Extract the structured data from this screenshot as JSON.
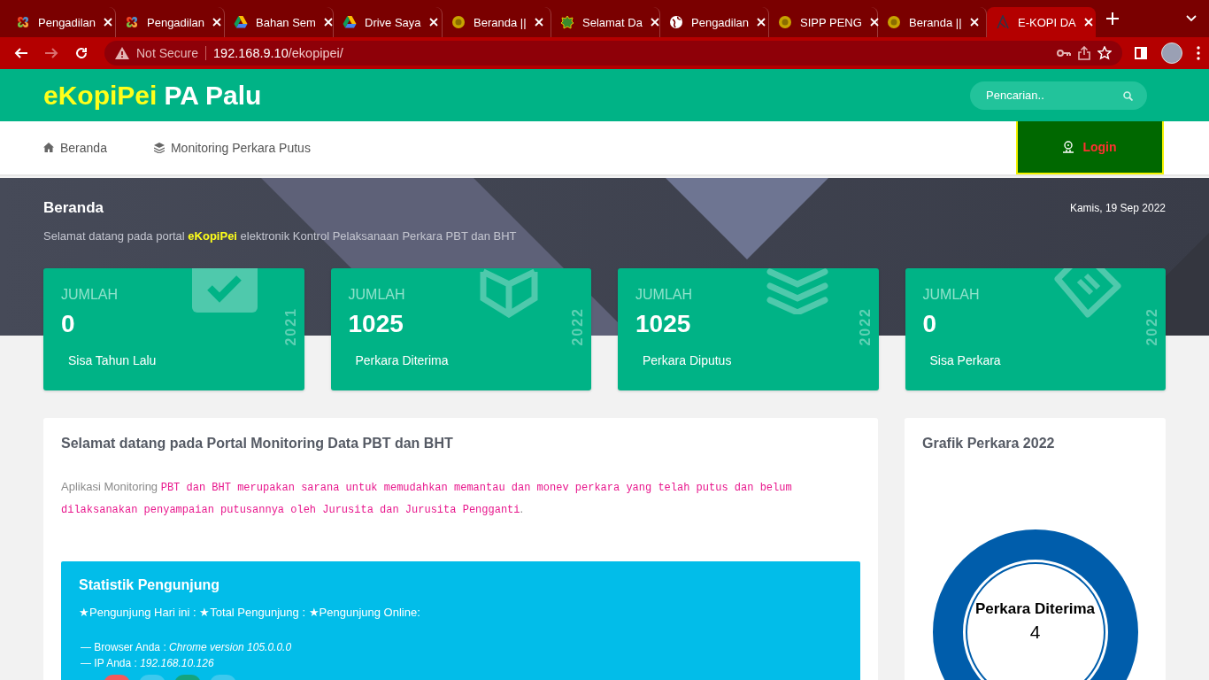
{
  "browser": {
    "tabs": [
      {
        "title": "Pengadilan",
        "kind": "joomla",
        "selected": false
      },
      {
        "title": "Pengadilan",
        "kind": "joomla",
        "selected": false
      },
      {
        "title": "Bahan Sem",
        "kind": "drive",
        "selected": false
      },
      {
        "title": "Drive Saya",
        "kind": "drive",
        "selected": false
      },
      {
        "title": "Beranda ||",
        "kind": "seal",
        "selected": false
      },
      {
        "title": "Selamat Da",
        "kind": "emblem",
        "selected": false
      },
      {
        "title": "Pengadilan",
        "kind": "globe",
        "selected": false
      },
      {
        "title": "SIPP PENG",
        "kind": "seal",
        "selected": false
      },
      {
        "title": "Beranda ||",
        "kind": "seal",
        "selected": false
      },
      {
        "title": "E-KOPI DA",
        "kind": "letter",
        "selected": true
      }
    ],
    "buttons": [
      {
        "kind": "back",
        "disabled": false
      },
      {
        "kind": "forward",
        "disabled": true
      },
      {
        "kind": "reload",
        "disabled": false
      }
    ],
    "address": {
      "security": "Not Secure",
      "host": "192.168.9.10",
      "path": "/ekopipei/"
    }
  },
  "site": {
    "brand": "eKopiPei",
    "title": "PA Palu",
    "search_placeholder": "Pencarian.."
  },
  "nav": {
    "items": [
      {
        "label": "Beranda",
        "kind": "home"
      },
      {
        "label": "Monitoring Perkara Putus",
        "kind": "layers"
      }
    ],
    "login": "Login"
  },
  "hero": {
    "title": "Beranda",
    "date": "Kamis, 19 Sep 2022",
    "welcome": "Selamat datang pada portal **eKopiPei**  elektronik Kontrol Pelaksanaan Perkara PBT dan BHT"
  },
  "stats": [
    {
      "kind": "check",
      "heading": "JUMLAH",
      "value": "0",
      "label": "Sisa Tahun Lalu",
      "year": "2021"
    },
    {
      "kind": "cube",
      "heading": "JUMLAH",
      "value": "1025",
      "label": "Perkara Diterima",
      "year": "2022"
    },
    {
      "kind": "layers",
      "heading": "JUMLAH",
      "value": "1025",
      "label": "Perkara Diputus",
      "year": "2022"
    },
    {
      "kind": "tag",
      "heading": "JUMLAH",
      "value": "0",
      "label": "Sisa Perkara",
      "year": "2022"
    }
  ],
  "welcome_panel": {
    "title": "Selamat datang pada Portal Monitoring Data PBT dan BHT",
    "intro": "Aplikasi Monitoring",
    "message": "PBT dan BHT merupakan sarana untuk memudahkan memantau dan monev perkara yang telah putus dan belum dilaksanakan penyampaian putusannya oleh Jurusita dan Jurusita Pengganti",
    "end": "."
  },
  "visitors": {
    "title": "Statistik Pengunjung",
    "counters": "★Pengunjung Hari ini : ★Total Pengunjung : ★Pengunjung Online:",
    "details": [
      "—  Browser Anda : *Chrome version 105.0.0.0*",
      "—  IP Anda : *192.168.10.126*"
    ],
    "share_buttons": [
      {
        "color": "#f55a5a"
      },
      {
        "color": "#3cc9ee"
      },
      {
        "color": "#16a47c"
      },
      {
        "color": "#3cc9ee"
      }
    ]
  },
  "chart_panel": {
    "title": "Grafik Perkara 2022",
    "center_label": "Perkara Diterima",
    "center_value": "4"
  }
}
